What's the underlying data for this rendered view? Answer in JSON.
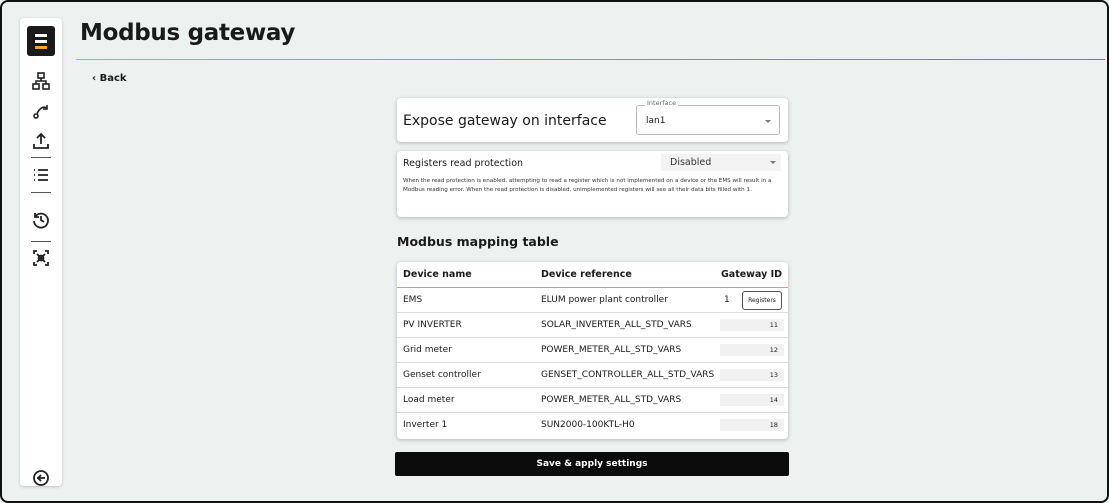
{
  "app": {
    "title": "Modbus gateway",
    "back_label": "Back"
  },
  "sidebar": {
    "items": [
      {
        "icon": "network-icon"
      },
      {
        "icon": "route-icon"
      },
      {
        "icon": "upload-icon"
      },
      {
        "icon": "list-icon"
      },
      {
        "icon": "history-icon"
      },
      {
        "icon": "scan-icon"
      }
    ],
    "logout_icon": "logout-icon"
  },
  "gateway": {
    "label": "Expose gateway on interface",
    "interface_legend": "Interface",
    "interface_value": "lan1"
  },
  "read_protection": {
    "label": "Registers read protection",
    "value": "Disabled",
    "description": "When the read protection is enabled, attempting to read a register which is not implemented on a device or the EMS will result in a Modbus reading error. When the read protection is disabled, unimplemented registers will see all their data bits filled with 1."
  },
  "mapping": {
    "title": "Modbus mapping table",
    "columns": [
      "Device name",
      "Device reference",
      "Gateway ID"
    ],
    "rows": [
      {
        "name": "EMS",
        "ref": "ELUM power plant controller",
        "id": "1",
        "button": "Registers"
      },
      {
        "name": "PV INVERTER",
        "ref": "SOLAR_INVERTER_ALL_STD_VARS",
        "id": "11"
      },
      {
        "name": "Grid meter",
        "ref": "POWER_METER_ALL_STD_VARS",
        "id": "12"
      },
      {
        "name": "Genset controller",
        "ref": "GENSET_CONTROLLER_ALL_STD_VARS",
        "id": "13"
      },
      {
        "name": "Load meter",
        "ref": "POWER_METER_ALL_STD_VARS",
        "id": "14"
      },
      {
        "name": "Inverter 1",
        "ref": "SUN2000-100KTL-H0",
        "id": "18"
      }
    ]
  },
  "save_label": "Save & apply settings",
  "colors": {
    "accent": "#f0a500",
    "accent_end": "#e05a2b",
    "background": "#edf1ef",
    "button": "#0c0c0c"
  }
}
